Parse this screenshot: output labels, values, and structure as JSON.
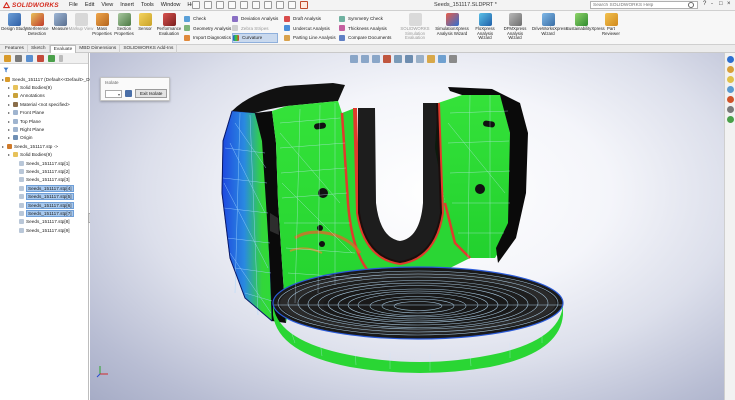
{
  "app": {
    "brand": "SOLIDWORKS",
    "document_title": "Seeds_151117.SLDPRT *",
    "accent_color": "#d52b1e"
  },
  "menu": [
    "File",
    "Edit",
    "View",
    "Insert",
    "Tools",
    "Window",
    "Help"
  ],
  "search": {
    "placeholder": "Search SOLIDWORKS Help"
  },
  "window_controls": [
    "?",
    "-",
    "□",
    "×"
  ],
  "ribbon": {
    "big_buttons": [
      {
        "label": "Design Study",
        "icon": "design-study-icon"
      },
      {
        "label": "Interference Detection",
        "icon": "interference-icon"
      },
      {
        "label": "Measure",
        "icon": "measure-icon"
      },
      {
        "label": "Markup View",
        "icon": "markup-icon"
      },
      {
        "label": "Mass Properties",
        "icon": "mass-properties-icon"
      },
      {
        "label": "Section Properties",
        "icon": "section-properties-icon"
      },
      {
        "label": "Sensor",
        "icon": "sensor-icon"
      },
      {
        "label": "Performance Evaluation",
        "icon": "performance-icon"
      }
    ],
    "col1": [
      "Check",
      "Geometry Analysis",
      "Import Diagnostics"
    ],
    "col2": [
      "Deviation Analysis",
      "Zebra Stripes",
      "Curvature"
    ],
    "col3": [
      "Draft Analysis",
      "Undercut Analysis",
      "Parting Line Analysis"
    ],
    "col4": [
      "Symmetry Check",
      "Thickness Analysis",
      "Compare Documents"
    ],
    "sim_buttons": [
      {
        "label": "SOLIDWORKS Simulation Evaluation",
        "icon": "simulation-eval-icon"
      },
      {
        "label": "SimulationXpress Analysis Wizard",
        "icon": "simulationxpress-icon"
      },
      {
        "label": "FloXpress Analysis Wizard",
        "icon": "floxpress-icon"
      },
      {
        "label": "DFMXpress Analysis Wizard",
        "icon": "dfmxpress-icon"
      },
      {
        "label": "DriveWorksXpress Wizard",
        "icon": "driveworksxpress-icon"
      },
      {
        "label": "SustainabilityXpress",
        "icon": "sustainability-icon"
      },
      {
        "label": "Part Reviewer",
        "icon": "part-reviewer-icon"
      }
    ]
  },
  "tabs": [
    "Features",
    "Sketch",
    "Evaluate",
    "MBD Dimensions",
    "SOLIDWORKS Add-Ins"
  ],
  "active_tab": "Evaluate",
  "tree": [
    {
      "label": "Seeds_151117 (Default<<Default>_Di",
      "level": 0,
      "icon": "part-icon"
    },
    {
      "label": "Solid Bodies(9)",
      "level": 1,
      "icon": "folder-icon"
    },
    {
      "label": "Annotations",
      "level": 1,
      "icon": "annotations-icon"
    },
    {
      "label": "Material <not specified>",
      "level": 1,
      "icon": "material-icon"
    },
    {
      "label": "Front Plane",
      "level": 1,
      "icon": "plane-icon"
    },
    {
      "label": "Top Plane",
      "level": 1,
      "icon": "plane-icon"
    },
    {
      "label": "Right Plane",
      "level": 1,
      "icon": "plane-icon"
    },
    {
      "label": "Origin",
      "level": 1,
      "icon": "origin-icon"
    },
    {
      "label": "Seeds_151117.stp ->",
      "level": 0,
      "icon": "import-icon"
    },
    {
      "label": "Solid Bodies(9)",
      "level": 1,
      "icon": "folder-icon"
    },
    {
      "label": "Seeds_151117.stp[1]",
      "level": 2,
      "icon": "body-icon"
    },
    {
      "label": "Seeds_151117.stp[2]",
      "level": 2,
      "icon": "body-icon"
    },
    {
      "label": "Seeds_151117.stp[3]",
      "level": 2,
      "icon": "body-icon"
    },
    {
      "label": "Seeds_151117.stp[4]",
      "level": 2,
      "icon": "body-icon",
      "selected": true
    },
    {
      "label": "Seeds_151117.stp[5]",
      "level": 2,
      "icon": "body-icon",
      "selected": true
    },
    {
      "label": "Seeds_151117.stp[6]",
      "level": 2,
      "icon": "body-icon",
      "selected": true
    },
    {
      "label": "Seeds_151117.stp[7]",
      "level": 2,
      "icon": "body-icon",
      "selected": true
    },
    {
      "label": "Seeds_151117.stp[8]",
      "level": 2,
      "icon": "body-icon"
    },
    {
      "label": "Seeds_151117.stp[9]",
      "level": 2,
      "icon": "body-icon"
    }
  ],
  "isolate": {
    "title": "Isolate",
    "exit_label": "Exit Isolate"
  }
}
